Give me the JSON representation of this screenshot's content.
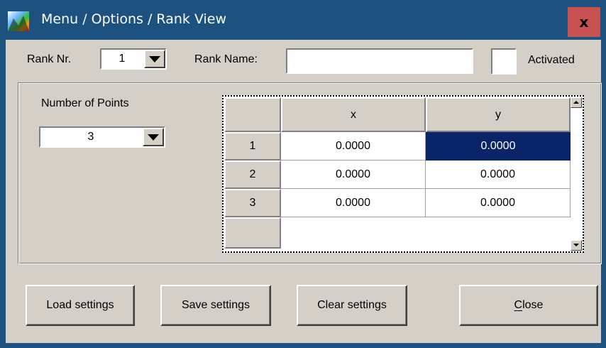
{
  "window": {
    "title": "Menu / Options / Rank View",
    "close_glyph": "x",
    "app_icon": "spectrum-app-icon",
    "titlebar_color": "#1c5180",
    "close_color": "#c75050"
  },
  "rank": {
    "nr_label": "Rank Nr.",
    "nr_value": "1",
    "name_label": "Rank Name:",
    "name_value": "",
    "activated_label": "Activated",
    "activated_checked": false
  },
  "points": {
    "label": "Number of Points",
    "value": "3"
  },
  "table": {
    "columns": [
      "x",
      "y"
    ],
    "rows": [
      {
        "index": "1",
        "x": "0.0000",
        "y": "0.0000"
      },
      {
        "index": "2",
        "x": "0.0000",
        "y": "0.0000"
      },
      {
        "index": "3",
        "x": "0.0000",
        "y": "0.0000"
      }
    ],
    "selected_cell": {
      "row": 1,
      "column": "y"
    },
    "selection_color": "#0a246a"
  },
  "buttons": {
    "load": "Load settings",
    "save": "Save settings",
    "clear": "Clear settings",
    "close": "Close"
  }
}
